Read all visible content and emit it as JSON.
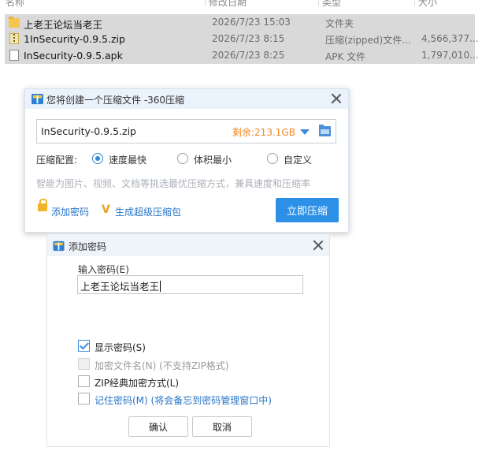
{
  "explorer": {
    "columns": [
      "名称",
      "修改日期",
      "类型",
      "大小"
    ],
    "files": [
      {
        "icon": "folder-icon",
        "name": "上老王论坛当老王",
        "date": "2026/7/23 15:03",
        "type": "文件夹",
        "size": ""
      },
      {
        "icon": "zip-file-icon",
        "name": "1InSecurity-0.9.5.zip",
        "date": "2026/7/23 8:15",
        "type": "压缩(zipped)文件...",
        "size": "4,566,377..."
      },
      {
        "icon": "apk-file-icon",
        "name": "InSecurity-0.9.5.apk",
        "date": "2026/7/23 8:25",
        "type": "APK 文件",
        "size": "1,797,010..."
      }
    ]
  },
  "compress_dialog": {
    "title": "您将创建一个压缩文件 -360压缩",
    "filename": "InSecurity-0.9.5.zip",
    "remaining": "剩余:213.1GB",
    "config_label": "压缩配置:",
    "options": [
      "速度最快",
      "体积最小",
      "自定义"
    ],
    "selected_option": "速度最快",
    "hint": "智能为图片、视频、文档等挑选最优压缩方式，兼具速度和压缩率",
    "add_password": "添加密码",
    "super_compress": "生成超级压缩包",
    "compress_now": "立即压缩",
    "accent_color": "#2b90e6",
    "remaining_color": "#f08a24"
  },
  "password_dialog": {
    "title": "添加密码",
    "input_label": "输入密码(E)",
    "password_value": "上老王论坛当老王",
    "checkboxes": [
      {
        "label": "显示密码(S)",
        "checked": true,
        "disabled": false
      },
      {
        "label": "加密文件名(N) (不支持ZIP格式)",
        "checked": false,
        "disabled": true
      },
      {
        "label": "ZIP经典加密方式(L)",
        "checked": false,
        "disabled": false
      },
      {
        "label": "记住密码(M) (将会备忘到密码管理窗口中)",
        "checked": false,
        "disabled": false
      }
    ],
    "ok": "确认",
    "cancel": "取消"
  }
}
